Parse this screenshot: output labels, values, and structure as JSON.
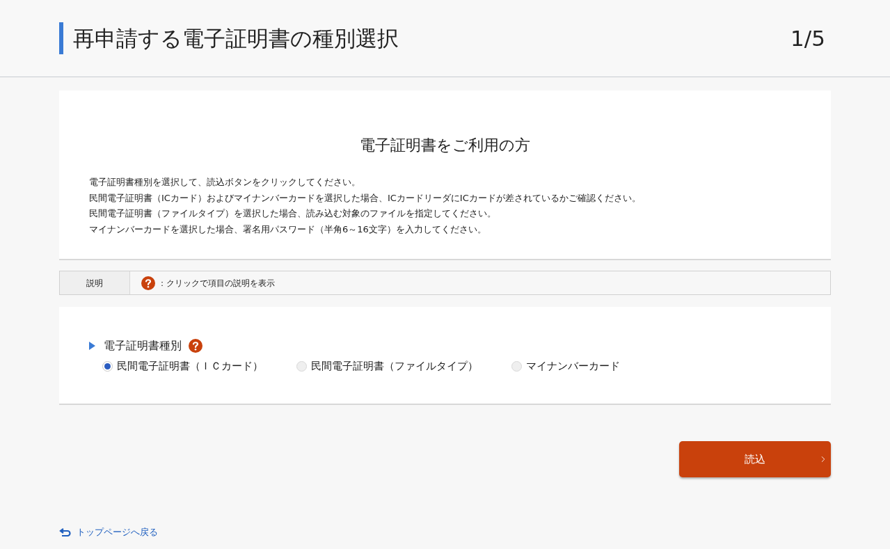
{
  "header": {
    "title": "再申請する電子証明書の種別選択",
    "step": "1/5"
  },
  "intro": {
    "heading": "電子証明書をご利用の方",
    "lines": [
      "電子証明書種別を選択して、読込ボタンをクリックしてください。",
      "民間電子証明書（ICカード）およびマイナンバーカードを選択した場合、ICカードリーダにICカードが差されているかご確認ください。",
      "民間電子証明書（ファイルタイプ）を選択した場合、読み込む対象のファイルを指定してください。",
      "マイナンバーカードを選択した場合、署名用パスワード（半角6～16文字）を入力してください。"
    ]
  },
  "legend": {
    "label": "説明",
    "text": "：クリックで項目の説明を表示"
  },
  "field": {
    "label": "電子証明書種別",
    "options": [
      {
        "label": "民間電子証明書（ＩＣカード）",
        "selected": true
      },
      {
        "label": "民間電子証明書（ファイルタイプ）",
        "selected": false
      },
      {
        "label": "マイナンバーカード",
        "selected": false
      }
    ]
  },
  "read_button": "読込",
  "back_link": "トップページへ戻る"
}
